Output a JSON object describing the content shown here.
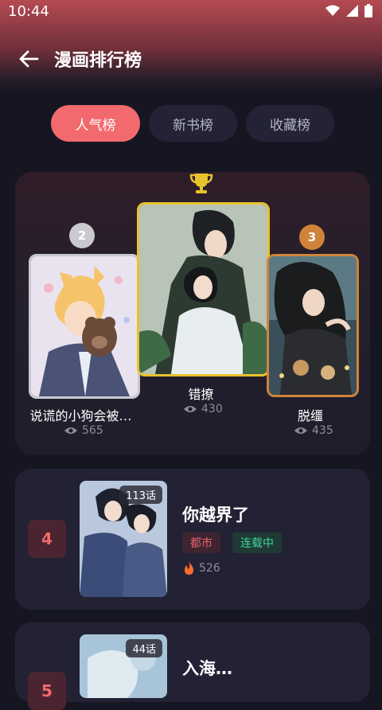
{
  "status": {
    "time": "10:44"
  },
  "header": {
    "title": "漫画排行榜"
  },
  "tabs": [
    {
      "label": "人气榜",
      "active": true
    },
    {
      "label": "新书榜",
      "active": false
    },
    {
      "label": "收藏榜",
      "active": false
    }
  ],
  "podium": {
    "first": {
      "rank": "1",
      "name": "错撩",
      "views": "430"
    },
    "second": {
      "rank": "2",
      "name": "说谎的小狗会被…",
      "views": "565"
    },
    "third": {
      "rank": "3",
      "name": "脱缰",
      "views": "435"
    }
  },
  "list": [
    {
      "rank": "4",
      "title": "你越界了",
      "chapters": "113话",
      "tags": [
        "都市",
        "连载中"
      ],
      "hot": "526"
    },
    {
      "rank": "5",
      "title": "入海…",
      "chapters": "44话"
    }
  ],
  "colors": {
    "accent": "#f26a6e",
    "silver": "#c9c9cf",
    "bronze": "#d0843a",
    "gold": "#e8c22c"
  }
}
